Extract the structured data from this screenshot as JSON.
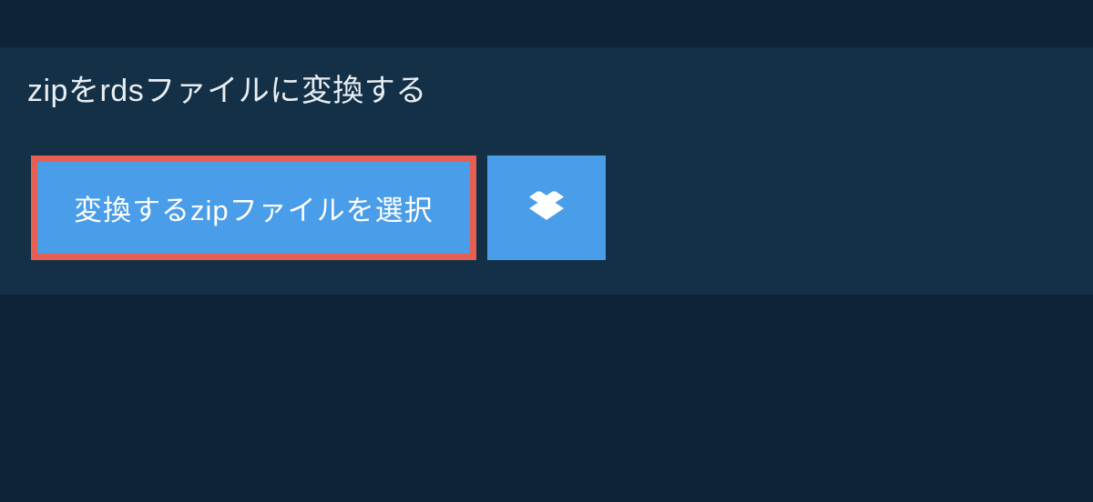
{
  "header": {
    "title": "zipをrdsファイルに変換する"
  },
  "buttons": {
    "select_file": "変換するzipファイルを選択"
  },
  "colors": {
    "background_outer": "#0d2438",
    "background_inner": "#133046",
    "button_primary": "#4a9de8",
    "button_border": "#e65f53",
    "text_light": "#e8eef2",
    "text_white": "#ffffff"
  }
}
